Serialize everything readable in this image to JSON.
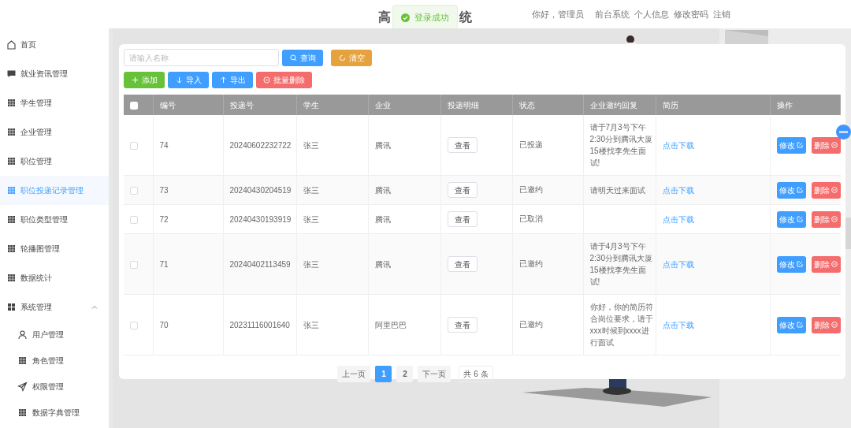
{
  "header": {
    "title_start": "高",
    "title_end": "统",
    "toast": "登录成功",
    "greeting": "你好，管理员",
    "links": [
      "前台系统",
      "个人信息",
      "修改密码",
      "注销"
    ]
  },
  "sidebar": {
    "items": [
      {
        "label": "首页",
        "selected": false
      },
      {
        "label": "就业资讯管理",
        "selected": false
      },
      {
        "label": "学生管理",
        "selected": false
      },
      {
        "label": "企业管理",
        "selected": false
      },
      {
        "label": "职位管理",
        "selected": false
      },
      {
        "label": "职位投递记录管理",
        "selected": true
      },
      {
        "label": "职位类型管理",
        "selected": false
      },
      {
        "label": "轮播图管理",
        "selected": false
      },
      {
        "label": "数据统计",
        "selected": false
      },
      {
        "label": "系统管理",
        "selected": false,
        "expanded": true,
        "children": [
          {
            "label": "用户管理",
            "selected": false
          },
          {
            "label": "角色管理",
            "selected": false
          },
          {
            "label": "权限管理",
            "selected": false
          },
          {
            "label": "数据字典管理",
            "selected": false
          }
        ]
      }
    ]
  },
  "search": {
    "placeholder": "请输入名称"
  },
  "search_buttons": [
    {
      "label": "查询",
      "kind": "primary"
    },
    {
      "label": "清空",
      "kind": "warning"
    }
  ],
  "toolbar": [
    {
      "label": "添加",
      "kind": "success"
    },
    {
      "label": "导入",
      "kind": "primary"
    },
    {
      "label": "导出",
      "kind": "primary"
    },
    {
      "label": "批量删除",
      "kind": "danger"
    }
  ],
  "table": {
    "header_checked": false,
    "columns": [
      "编号",
      "投递号",
      "学生",
      "企业",
      "投递明细",
      "状态",
      "企业邀约回复",
      "简历",
      "操作"
    ],
    "rows": [
      {
        "checked": false,
        "cells": [
          "74",
          "20240602232722",
          "张三",
          "腾讯",
          "查看",
          "已投递",
          "请于7月3号下午2:30分到腾讯大厦15楼找李先生面试!",
          "点击下载"
        ],
        "actions": [
          "修改",
          "删除"
        ]
      },
      {
        "checked": false,
        "cells": [
          "73",
          "20240430204519",
          "张三",
          "腾讯",
          "查看",
          "已邀约",
          "请明天过来面试",
          "点击下载"
        ],
        "actions": [
          "修改",
          "删除"
        ]
      },
      {
        "checked": false,
        "cells": [
          "72",
          "20240430193919",
          "张三",
          "腾讯",
          "查看",
          "已取消",
          "",
          "点击下载"
        ],
        "actions": [
          "修改",
          "删除"
        ]
      },
      {
        "checked": false,
        "cells": [
          "71",
          "20240402113459",
          "张三",
          "腾讯",
          "查看",
          "已邀约",
          "请于4月3号下午2:30分到腾讯大厦15楼找李先生面试!",
          "点击下载"
        ],
        "actions": [
          "修改",
          "删除"
        ]
      },
      {
        "checked": false,
        "cells": [
          "70",
          "20231116001640",
          "张三",
          "阿里巴巴",
          "查看",
          "已邀约",
          "你好，你的简历符合岗位要求，请于xxx时候到xxxx进行面试",
          "点击下载"
        ],
        "actions": [
          "修改",
          "删除"
        ]
      }
    ]
  },
  "pagination": {
    "prev": "上一页",
    "pages": [
      {
        "label": "1",
        "selected": true
      },
      {
        "label": "2",
        "selected": false
      }
    ],
    "next": "下一页",
    "total": "共 6 条"
  }
}
